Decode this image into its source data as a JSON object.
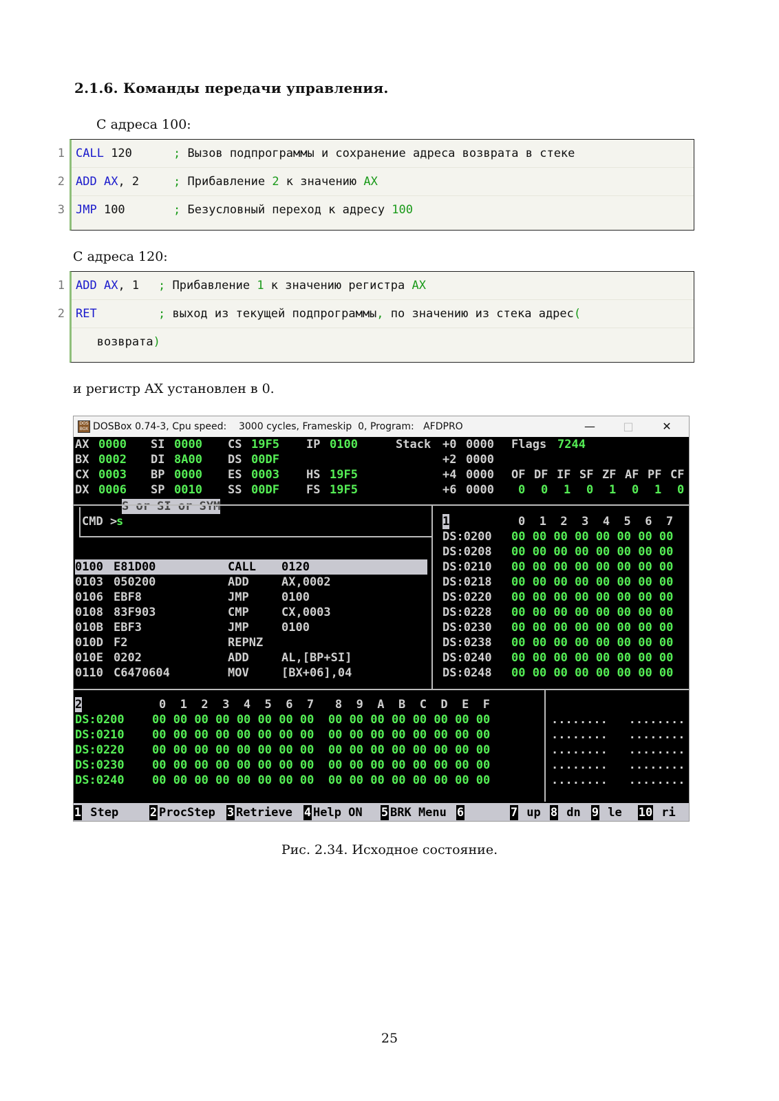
{
  "heading": "2.1.6. Команды передачи управления.",
  "para1": "С адреса 100:",
  "code1": [
    {
      "num": "1",
      "parts": [
        {
          "c": "kw",
          "t": "CALL"
        },
        {
          "c": "plain",
          "t": " 120"
        }
      ],
      "comment": [
        {
          "c": "pun",
          "t": ";"
        },
        {
          "c": "plain",
          "t": " Вызов подпрограммы и сохранение адреса возврата в стеке"
        }
      ]
    },
    {
      "num": "2",
      "parts": [
        {
          "c": "kw",
          "t": "ADD"
        },
        {
          "c": "plain",
          "t": " "
        },
        {
          "c": "kw",
          "t": "AX"
        },
        {
          "c": "plain",
          "t": ", 2"
        }
      ],
      "comment": [
        {
          "c": "pun",
          "t": ";"
        },
        {
          "c": "plain",
          "t": " Прибавление "
        },
        {
          "c": "num",
          "t": "2"
        },
        {
          "c": "plain",
          "t": " к значению "
        },
        {
          "c": "num",
          "t": "AX"
        }
      ]
    },
    {
      "num": "3",
      "parts": [
        {
          "c": "kw",
          "t": "JMP"
        },
        {
          "c": "plain",
          "t": " 100"
        }
      ],
      "comment": [
        {
          "c": "pun",
          "t": ";"
        },
        {
          "c": "plain",
          "t": " Безусловный переход к адресу "
        },
        {
          "c": "num",
          "t": "100"
        }
      ]
    }
  ],
  "para2": "С адреса 120:",
  "code2": [
    {
      "num": "1",
      "parts": [
        {
          "c": "kw",
          "t": "ADD"
        },
        {
          "c": "plain",
          "t": " "
        },
        {
          "c": "kw",
          "t": "AX"
        },
        {
          "c": "plain",
          "t": ", 1"
        }
      ],
      "comment": [
        {
          "c": "pun",
          "t": ";"
        },
        {
          "c": "plain",
          "t": " Прибавление "
        },
        {
          "c": "num",
          "t": "1"
        },
        {
          "c": "plain",
          "t": " к значению регистра "
        },
        {
          "c": "num",
          "t": "AX"
        }
      ]
    },
    {
      "num": "2",
      "parts": [
        {
          "c": "kw",
          "t": "RET"
        }
      ],
      "comment": [
        {
          "c": "pun",
          "t": ";"
        },
        {
          "c": "plain",
          "t": " выход из текущей подпрограммы"
        },
        {
          "c": "pun",
          "t": ","
        },
        {
          "c": "plain",
          "t": " по значению из стека адрес"
        },
        {
          "c": "pun",
          "t": "("
        }
      ]
    },
    {
      "num": "",
      "parts": [
        {
          "c": "plain",
          "t": "   возврата"
        },
        {
          "c": "pun",
          "t": ")"
        }
      ],
      "comment": []
    }
  ],
  "para3": "и регистр AX установлен в 0.",
  "dosbox": {
    "title": "DOSBox 0.74-3, Cpu speed:    3000 cycles, Frameskip  0, Program:   AFDPRO",
    "logo": "DOS BOX",
    "regs": [
      [
        {
          "l": "AX",
          "v": "0000"
        },
        {
          "l": "SI",
          "v": "0000"
        },
        {
          "l": "CS",
          "v": "19F5"
        },
        {
          "l": "IP",
          "v": "0100"
        }
      ],
      [
        {
          "l": "BX",
          "v": "0002"
        },
        {
          "l": "DI",
          "v": "8A00"
        },
        {
          "l": "DS",
          "v": "00DF"
        },
        {
          "l": "",
          "v": ""
        }
      ],
      [
        {
          "l": "CX",
          "v": "0003"
        },
        {
          "l": "BP",
          "v": "0000"
        },
        {
          "l": "ES",
          "v": "0003"
        },
        {
          "l": "HS",
          "v": "19F5"
        }
      ],
      [
        {
          "l": "DX",
          "v": "0006"
        },
        {
          "l": "SP",
          "v": "0010"
        },
        {
          "l": "SS",
          "v": "00DF"
        },
        {
          "l": "FS",
          "v": "19F5"
        }
      ]
    ],
    "stack_label": "Stack",
    "stack": [
      {
        "o": "+0",
        "v": "0000"
      },
      {
        "o": "+2",
        "v": "0000"
      },
      {
        "o": "+4",
        "v": "0000"
      },
      {
        "o": "+6",
        "v": "0000"
      }
    ],
    "flags_label": "Flags",
    "flags_value": "7244",
    "flag_names": [
      "OF",
      "DF",
      "IF",
      "SF",
      "ZF",
      "AF",
      "PF",
      "CF"
    ],
    "flag_values": [
      "0",
      "0",
      "1",
      "0",
      "1",
      "0",
      "1",
      "0"
    ],
    "cmd_hint": "S or SI or SYM",
    "cmd_label": "CMD >",
    "cmd_value": "s",
    "disasm": [
      {
        "addr": "0100",
        "hex": "E81D00",
        "mn": "CALL",
        "op": "0120"
      },
      {
        "addr": "0103",
        "hex": "050200",
        "mn": "ADD",
        "op": "AX,0002"
      },
      {
        "addr": "0106",
        "hex": "EBF8",
        "mn": "JMP",
        "op": "0100"
      },
      {
        "addr": "0108",
        "hex": "83F903",
        "mn": "CMP",
        "op": "CX,0003"
      },
      {
        "addr": "010B",
        "hex": "EBF3",
        "mn": "JMP",
        "op": "0100"
      },
      {
        "addr": "010D",
        "hex": "F2",
        "mn": "REPNZ",
        "op": ""
      },
      {
        "addr": "010E",
        "hex": "0202",
        "mn": "ADD",
        "op": "AL,[BP+SI]"
      },
      {
        "addr": "0110",
        "hex": "C6470604",
        "mn": "MOV",
        "op": "[BX+06],04"
      }
    ],
    "mem1_id": "1",
    "mem1_cols": "0  1  2  3  4  5  6  7",
    "mem1_rows": [
      {
        "a": "DS:0200",
        "b": "00 00 00 00 00 00 00 00"
      },
      {
        "a": "DS:0208",
        "b": "00 00 00 00 00 00 00 00"
      },
      {
        "a": "DS:0210",
        "b": "00 00 00 00 00 00 00 00"
      },
      {
        "a": "DS:0218",
        "b": "00 00 00 00 00 00 00 00"
      },
      {
        "a": "DS:0220",
        "b": "00 00 00 00 00 00 00 00"
      },
      {
        "a": "DS:0228",
        "b": "00 00 00 00 00 00 00 00"
      },
      {
        "a": "DS:0230",
        "b": "00 00 00 00 00 00 00 00"
      },
      {
        "a": "DS:0238",
        "b": "00 00 00 00 00 00 00 00"
      },
      {
        "a": "DS:0240",
        "b": "00 00 00 00 00 00 00 00"
      },
      {
        "a": "DS:0248",
        "b": "00 00 00 00 00 00 00 00"
      }
    ],
    "mem2_id": "2",
    "mem2_cols": "0  1  2  3  4  5  6  7   8  9  A  B  C  D  E  F",
    "mem2_rows": [
      {
        "a": "DS:0200",
        "b": "00 00 00 00 00 00 00 00  00 00 00 00 00 00 00 00",
        "c": "........   ........"
      },
      {
        "a": "DS:0210",
        "b": "00 00 00 00 00 00 00 00  00 00 00 00 00 00 00 00",
        "c": "........   ........"
      },
      {
        "a": "DS:0220",
        "b": "00 00 00 00 00 00 00 00  00 00 00 00 00 00 00 00",
        "c": "........   ........"
      },
      {
        "a": "DS:0230",
        "b": "00 00 00 00 00 00 00 00  00 00 00 00 00 00 00 00",
        "c": "........   ........"
      },
      {
        "a": "DS:0240",
        "b": "00 00 00 00 00 00 00 00  00 00 00 00 00 00 00 00",
        "c": "........   ........"
      }
    ],
    "fkeys": [
      {
        "n": "1",
        "l": " Step"
      },
      {
        "n": "2",
        "l": "ProcStep"
      },
      {
        "n": "3",
        "l": "Retrieve"
      },
      {
        "n": "4",
        "l": "Help ON"
      },
      {
        "n": "5",
        "l": "BRK Menu"
      },
      {
        "n": "6",
        "l": ""
      },
      {
        "n": "7",
        "l": " up"
      },
      {
        "n": "8",
        "l": " dn"
      },
      {
        "n": "9",
        "l": " le"
      },
      {
        "n": "10",
        "l": " ri"
      }
    ]
  },
  "caption": "Рис. 2.34. Исходное состояние.",
  "page_number": "25"
}
